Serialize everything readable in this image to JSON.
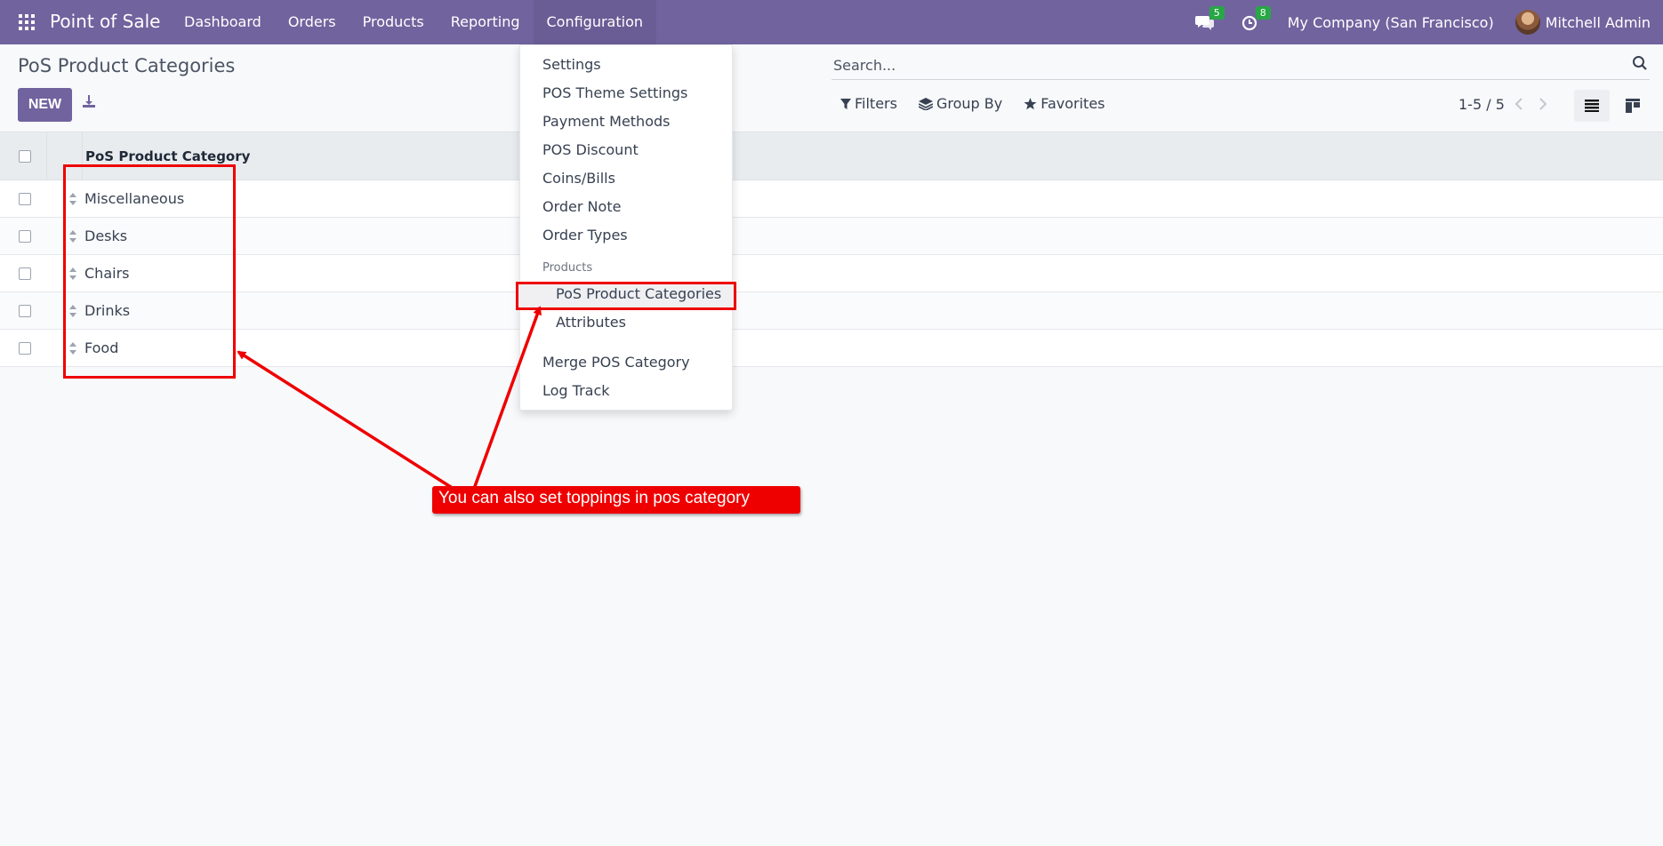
{
  "app": {
    "brand": "Point of Sale",
    "menu": [
      "Dashboard",
      "Orders",
      "Products",
      "Reporting",
      "Configuration"
    ],
    "active_menu": "Configuration",
    "messages_count": "5",
    "activities_count": "8",
    "company": "My Company (San Francisco)",
    "user": "Mitchell Admin"
  },
  "control_panel": {
    "title": "PoS Product Categories",
    "new_label": "NEW",
    "search_placeholder": "Search...",
    "filters_label": "Filters",
    "group_by_label": "Group By",
    "favorites_label": "Favorites",
    "pager": "1-5 / 5"
  },
  "list": {
    "column": "PoS Product Category",
    "rows": [
      "Miscellaneous",
      "Desks",
      "Chairs",
      "Drinks",
      "Food"
    ]
  },
  "dropdown": {
    "items": [
      "Settings",
      "POS Theme Settings",
      "Payment Methods",
      "POS Discount",
      "Coins/Bills",
      "Order Note",
      "Order Types"
    ],
    "section_header": "Products",
    "sub_items": [
      "PoS Product Categories",
      "Attributes"
    ],
    "bottom_items": [
      "Merge POS Category",
      "Log Track"
    ]
  },
  "annotation": {
    "callout": "You can also set toppings in pos category",
    "color": "#ef0000"
  },
  "colors": {
    "brand": "#71639e"
  }
}
